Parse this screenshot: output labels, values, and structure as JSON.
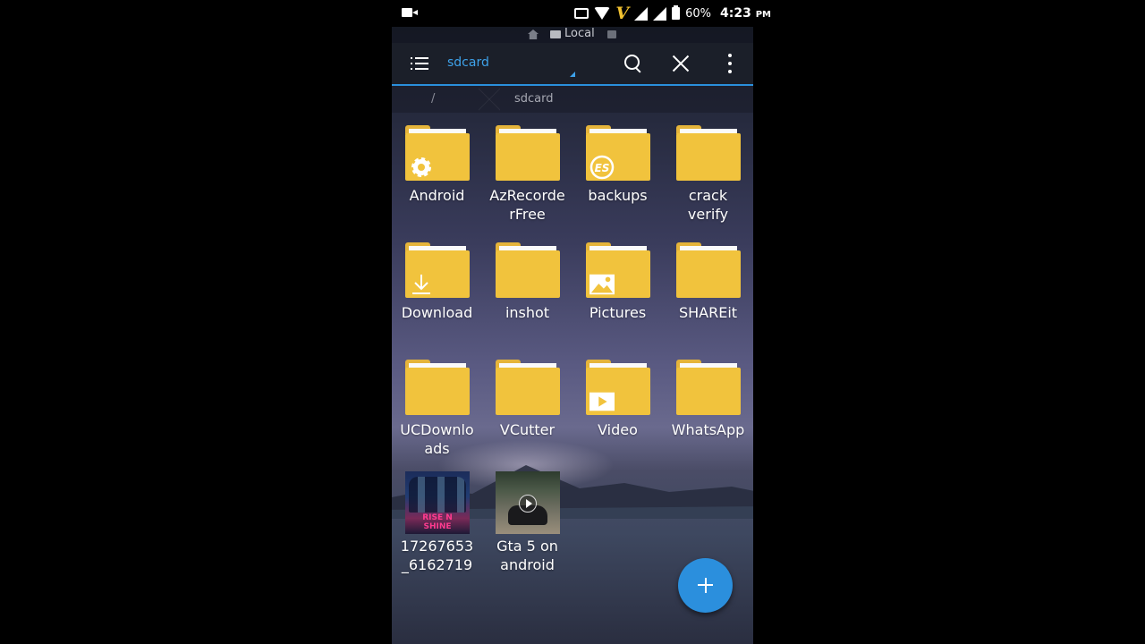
{
  "status_bar": {
    "battery": "60%",
    "time": "4:23",
    "ampm": "PM"
  },
  "location_bar": {
    "label": "Local"
  },
  "toolbar": {
    "path": "sdcard"
  },
  "breadcrumb": {
    "root": "/",
    "current": "sdcard"
  },
  "items": [
    {
      "label": "Android",
      "kind": "folder",
      "badge": "gear-icon"
    },
    {
      "label": "AzRecorderFree",
      "kind": "folder"
    },
    {
      "label": "backups",
      "kind": "folder",
      "badge": "es-icon"
    },
    {
      "label": "crack verify",
      "kind": "folder"
    },
    {
      "label": "Download",
      "kind": "folder",
      "badge": "download-icon"
    },
    {
      "label": "inshot",
      "kind": "folder"
    },
    {
      "label": "Pictures",
      "kind": "folder",
      "badge": "image-icon"
    },
    {
      "label": "SHAREit",
      "kind": "folder"
    },
    {
      "label": "UCDownloads",
      "kind": "folder"
    },
    {
      "label": "VCutter",
      "kind": "folder"
    },
    {
      "label": "Video",
      "kind": "folder",
      "badge": "play-icon"
    },
    {
      "label": "WhatsApp",
      "kind": "folder"
    },
    {
      "label": "17267653_6162719",
      "kind": "image",
      "thumb_text": "RISE N SHINE"
    },
    {
      "label": "Gta 5 on android",
      "kind": "video"
    }
  ],
  "accent_color": "#2b8fdd",
  "folder_color": "#f1c33d"
}
